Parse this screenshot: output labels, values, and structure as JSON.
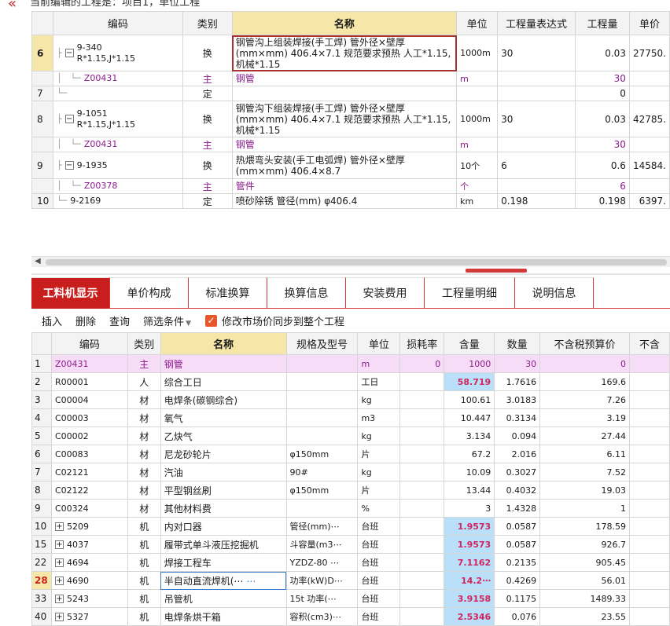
{
  "top_bar": {
    "collapse_icon": "double-chevron-left-icon",
    "title": "当前编辑的工程是：项目1，单位工程"
  },
  "upper": {
    "columns": [
      "",
      "编码",
      "类别",
      "名称",
      "单位",
      "工程量表达式",
      "工程量",
      "单价"
    ],
    "rows": [
      {
        "num": "6",
        "code": "9-340",
        "code2": "R*1.15,J*1.15",
        "type": "换",
        "name": "钢管沟上组装焊接(手工焊) 管外径×壁厚(mm×mm) 406.4×7.1  规范要求预热 人工*1.15,机械*1.15",
        "unit": "1000m",
        "expr": "30",
        "qty": "0.03",
        "price": "27750."
      },
      {
        "num": "",
        "code": "Z00431",
        "type": "主",
        "name": "钢管",
        "unit": "m",
        "expr": "",
        "qty": "30",
        "price": ""
      },
      {
        "num": "7",
        "code": "",
        "type": "定",
        "name": "",
        "unit": "",
        "expr": "",
        "qty": "0",
        "price": ""
      },
      {
        "num": "8",
        "code": "9-1051",
        "code2": "R*1.15,J*1.15",
        "type": "换",
        "name": "钢管沟下组装焊接(手工焊) 管外径×壁厚(mm×mm) 406.4×7.1  规范要求预热 人工*1.15,机械*1.15",
        "unit": "1000m",
        "expr": "30",
        "qty": "0.03",
        "price": "42785."
      },
      {
        "num": "",
        "code": "Z00431",
        "type": "主",
        "name": "钢管",
        "unit": "m",
        "expr": "",
        "qty": "30",
        "price": ""
      },
      {
        "num": "9",
        "code": "9-1935",
        "type": "换",
        "name": "热煨弯头安装(手工电弧焊) 管外径×壁厚(mm×mm) 406.4×8.7",
        "unit": "10个",
        "expr": "6",
        "qty": "0.6",
        "price": "14584."
      },
      {
        "num": "",
        "code": "Z00378",
        "type": "主",
        "name": "管件",
        "unit": "个",
        "expr": "",
        "qty": "6",
        "price": ""
      },
      {
        "num": "10",
        "code": "9-2169",
        "type": "定",
        "name": "喷砂除锈 管径(mm) φ406.4",
        "unit": "km",
        "expr": "0.198",
        "qty": "0.198",
        "price": "6397."
      }
    ]
  },
  "tabs": [
    "工料机显示",
    "单价构成",
    "标准换算",
    "换算信息",
    "安装费用",
    "工程量明细",
    "说明信息"
  ],
  "toolbar": {
    "insert": "插入",
    "delete": "删除",
    "query": "查询",
    "filter": "筛选条件",
    "sync_label": "修改市场价同步到整个工程"
  },
  "lower": {
    "columns": [
      "",
      "编码",
      "类别",
      "名称",
      "规格及型号",
      "单位",
      "损耗率",
      "含量",
      "数量",
      "不含税预算价",
      "不含"
    ],
    "rows": [
      {
        "num": "1",
        "code": "Z00431",
        "type": "主",
        "name": "钢管",
        "spec": "",
        "unit": "m",
        "loss": "0",
        "content": "1000",
        "qty": "30",
        "price": "0"
      },
      {
        "num": "2",
        "code": "R00001",
        "type": "人",
        "name": "综合工日",
        "spec": "",
        "unit": "工日",
        "loss": "",
        "content": "58.719",
        "qty": "1.7616",
        "price": "169.6"
      },
      {
        "num": "3",
        "code": "C00004",
        "type": "材",
        "name": "电焊条(碳钢综合)",
        "spec": "",
        "unit": "kg",
        "loss": "",
        "content": "100.61",
        "qty": "3.0183",
        "price": "7.26"
      },
      {
        "num": "4",
        "code": "C00003",
        "type": "材",
        "name": "氧气",
        "spec": "",
        "unit": "m3",
        "loss": "",
        "content": "10.447",
        "qty": "0.3134",
        "price": "3.19"
      },
      {
        "num": "5",
        "code": "C00002",
        "type": "材",
        "name": "乙炔气",
        "spec": "",
        "unit": "kg",
        "loss": "",
        "content": "3.134",
        "qty": "0.094",
        "price": "27.44"
      },
      {
        "num": "6",
        "code": "C00083",
        "type": "材",
        "name": "尼龙砂轮片",
        "spec": "φ150mm",
        "unit": "片",
        "loss": "",
        "content": "67.2",
        "qty": "2.016",
        "price": "6.11"
      },
      {
        "num": "7",
        "code": "C02121",
        "type": "材",
        "name": "汽油",
        "spec": "90#",
        "unit": "kg",
        "loss": "",
        "content": "10.09",
        "qty": "0.3027",
        "price": "7.52"
      },
      {
        "num": "8",
        "code": "C02122",
        "type": "材",
        "name": "平型钢丝刷",
        "spec": "φ150mm",
        "unit": "片",
        "loss": "",
        "content": "13.44",
        "qty": "0.4032",
        "price": "19.03"
      },
      {
        "num": "9",
        "code": "C00324",
        "type": "材",
        "name": "其他材料费",
        "spec": "",
        "unit": "%",
        "loss": "",
        "content": "3",
        "qty": "1.4328",
        "price": "1"
      },
      {
        "num": "10",
        "code": "5209",
        "type": "机",
        "name": "内对口器",
        "spec": "管径(mm)⋯",
        "unit": "台班",
        "loss": "",
        "content": "1.9573",
        "qty": "0.0587",
        "price": "178.59"
      },
      {
        "num": "15",
        "code": "4037",
        "type": "机",
        "name": "履带式单斗液压挖掘机",
        "spec": "斗容量(m3⋯",
        "unit": "台班",
        "loss": "",
        "content": "1.9573",
        "qty": "0.0587",
        "price": "926.7"
      },
      {
        "num": "22",
        "code": "4694",
        "type": "机",
        "name": "焊接工程车",
        "spec": "YZDZ-80 ⋯",
        "unit": "台班",
        "loss": "",
        "content": "7.1162",
        "qty": "0.2135",
        "price": "905.45"
      },
      {
        "num": "28",
        "code": "4690",
        "type": "机",
        "name": "半自动直流焊机(⋯",
        "spec": "功率(kW)D⋯",
        "unit": "台班",
        "loss": "",
        "content": "14.2⋯",
        "qty": "0.4269",
        "price": "56.01"
      },
      {
        "num": "33",
        "code": "5243",
        "type": "机",
        "name": "吊管机",
        "spec": "15t 功率(⋯",
        "unit": "台班",
        "loss": "",
        "content": "3.9158",
        "qty": "0.1175",
        "price": "1489.33"
      },
      {
        "num": "40",
        "code": "5327",
        "type": "机",
        "name": "电焊条烘干箱",
        "spec": "容积(cm3)⋯",
        "unit": "台班",
        "loss": "",
        "content": "2.5346",
        "qty": "0.076",
        "price": "23.55"
      }
    ]
  },
  "colors": {
    "accent": "#c81e1e",
    "header_highlight": "#f6e7a8",
    "main_row": "#f7dcf7",
    "content_highlight": "#b9e0f8"
  }
}
